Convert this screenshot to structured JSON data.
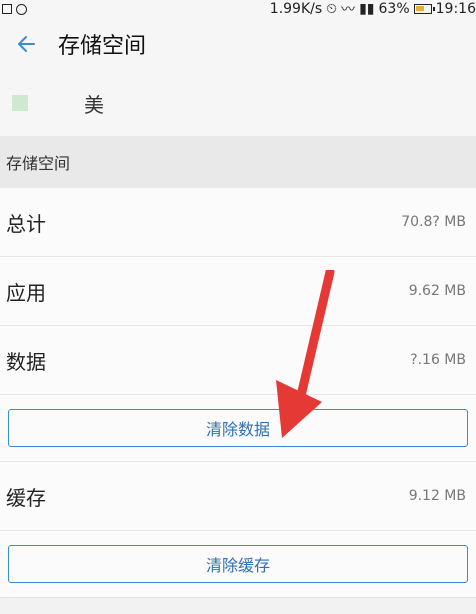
{
  "statusbar": {
    "network_speed": "1.99K/s",
    "battery": "63%",
    "time": "19:16",
    "battery_level": 0.63
  },
  "header": {
    "title": "存储空间",
    "back_icon": "arrow-left-icon"
  },
  "app": {
    "name_fragment": "美"
  },
  "section": {
    "title": "存储空间"
  },
  "rows": {
    "total": {
      "label": "总计",
      "value": "70.8? MB"
    },
    "apps": {
      "label": "应用",
      "value": "9.62 MB"
    },
    "data": {
      "label": "数据",
      "value": "?.16 MB"
    },
    "cache": {
      "label": "缓存",
      "value": "9.12 MB"
    }
  },
  "buttons": {
    "clear_data": "清除数据",
    "clear_cache": "清除缓存"
  },
  "colors": {
    "accent": "#3a8cd6",
    "annotation": "#e53935"
  }
}
